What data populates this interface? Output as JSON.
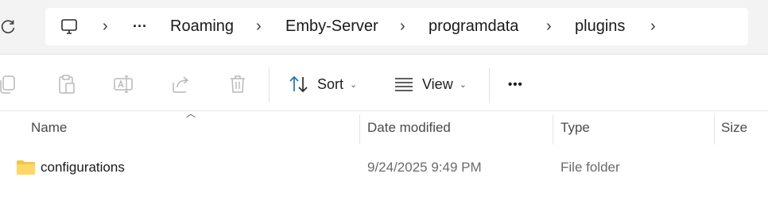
{
  "breadcrumb": {
    "items": [
      "Roaming",
      "Emby-Server",
      "programdata",
      "plugins"
    ],
    "ellipsis": "···"
  },
  "toolbar": {
    "sort_label": "Sort",
    "view_label": "View",
    "more_label": "•••"
  },
  "columns": {
    "name": "Name",
    "date_modified": "Date modified",
    "type": "Type",
    "size": "Size"
  },
  "files": [
    {
      "name": "configurations",
      "date_modified": "9/24/2025 9:49 PM",
      "type": "File folder",
      "size": ""
    }
  ],
  "colors": {
    "accent": "#1a73c7",
    "folder": "#f4c542"
  }
}
